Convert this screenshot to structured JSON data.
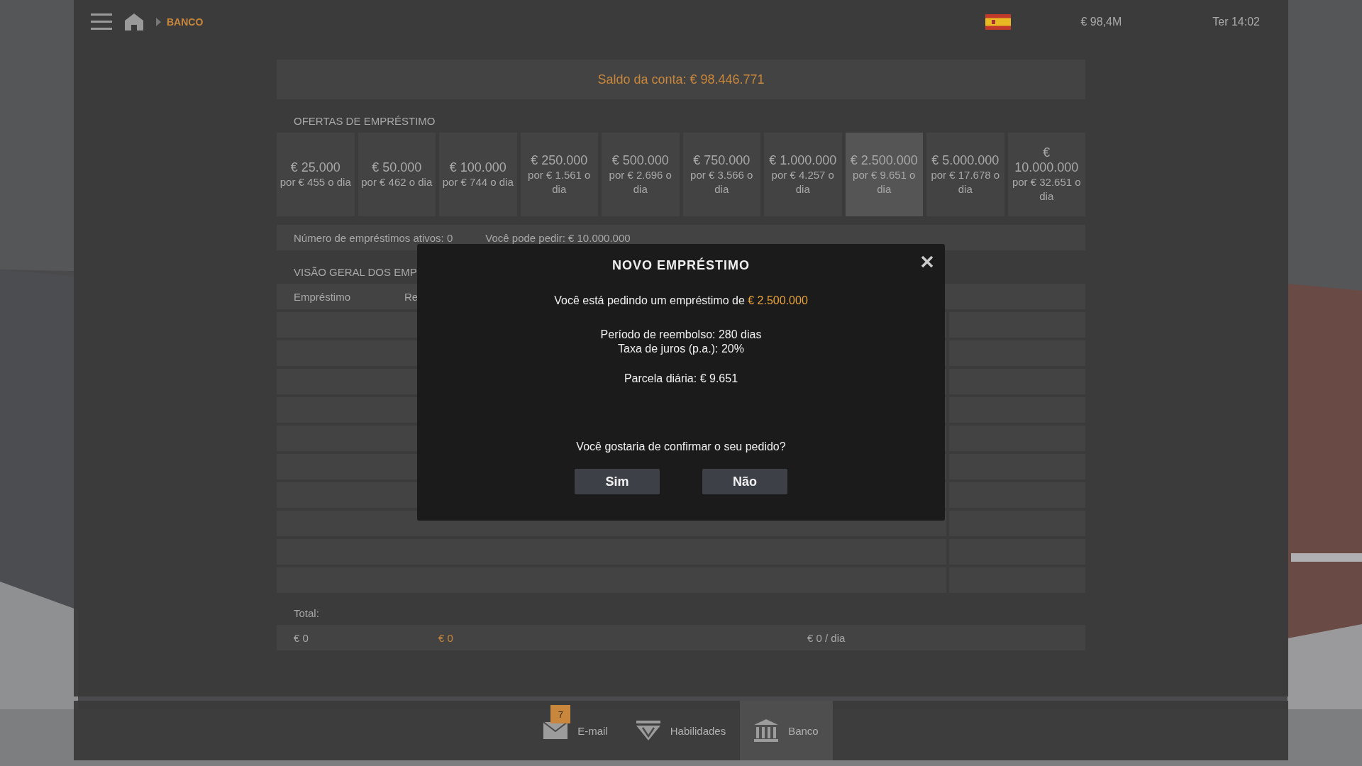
{
  "top_bar": {
    "breadcrumb": "BANCO",
    "money": "€ 98,4M",
    "clock": "Ter 14:02"
  },
  "balance": "Saldo da conta: € 98.446.771",
  "offers_title": "OFERTAS DE EMPRÉSTIMO",
  "offers": [
    {
      "amount": "€ 25.000",
      "daily": "por € 455 o dia",
      "selected": false
    },
    {
      "amount": "€ 50.000",
      "daily": "por € 462 o dia",
      "selected": false
    },
    {
      "amount": "€ 100.000",
      "daily": "por € 744 o dia",
      "selected": false
    },
    {
      "amount": "€ 250.000",
      "daily": "por € 1.561 o dia",
      "selected": false
    },
    {
      "amount": "€ 500.000",
      "daily": "por € 2.696 o dia",
      "selected": false
    },
    {
      "amount": "€ 750.000",
      "daily": "por € 3.566 o dia",
      "selected": false
    },
    {
      "amount": "€ 1.000.000",
      "daily": "por € 4.257 o dia",
      "selected": false
    },
    {
      "amount": "€ 2.500.000",
      "daily": "por € 9.651 o dia",
      "selected": true
    },
    {
      "amount": "€ 5.000.000",
      "daily": "por € 17.678 o dia",
      "selected": false
    },
    {
      "amount": "€ 10.000.000",
      "daily": "por € 32.651 o dia",
      "selected": false
    }
  ],
  "info": {
    "active_loans": "Número de empréstimos ativos: 0",
    "can_request": "Você pode pedir: € 10.000.000"
  },
  "overview_title": "VISÃO GERAL DOS EMP",
  "table": {
    "columns": [
      "Empréstimo",
      "Re"
    ]
  },
  "total_label": "Total:",
  "totals": [
    {
      "text": "€ 0",
      "kind": "plain"
    },
    {
      "text": "€ 0",
      "kind": "accent"
    },
    {
      "text": "€ 0 / dia",
      "kind": "plain"
    }
  ],
  "nav": [
    {
      "label": "E-mail",
      "kind": "mail",
      "badge": "7",
      "selected": false
    },
    {
      "label": "Habilidades",
      "kind": "skills",
      "selected": false
    },
    {
      "label": "Banco",
      "kind": "bank",
      "selected": true
    }
  ],
  "modal": {
    "title": "NOVO EMPRÉSTIMO",
    "request": "Você está pedindo um empréstimo de **€ 2.500.000**",
    "period": "Período de reembolso: 280 dias",
    "interest": "Taxa de juros (p.a.): 20%",
    "daily": "Parcela diária: € 9.651",
    "question": "Você gostaria de confirmar o seu pedido?",
    "buttons": [
      "Sim",
      "Não"
    ]
  }
}
